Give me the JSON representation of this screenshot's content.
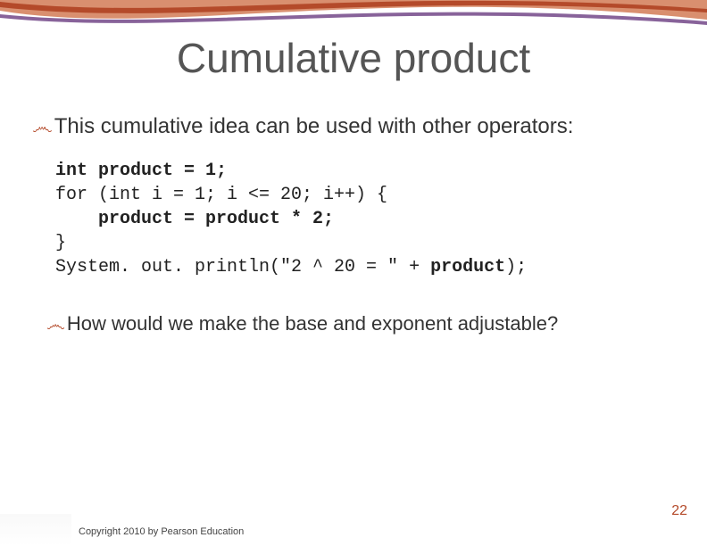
{
  "title": "Cumulative product",
  "bullets": {
    "main": "This cumulative idea can be used with other operators:",
    "sub": "How would we make the base and exponent adjustable?"
  },
  "code": {
    "l1a": "int product = 1;",
    "l2": "for (int i = 1; i <= 20; i++) {",
    "l3a": "    ",
    "l3b": "product = product * 2;",
    "l4": "}",
    "l5a": "System. out. println(\"2 ^ 20 = \" + ",
    "l5b": "product",
    "l5c": ");"
  },
  "footer": {
    "copyright": "Copyright 2010 by Pearson Education",
    "page": "22"
  },
  "glyphs": {
    "bullet": "෴"
  }
}
